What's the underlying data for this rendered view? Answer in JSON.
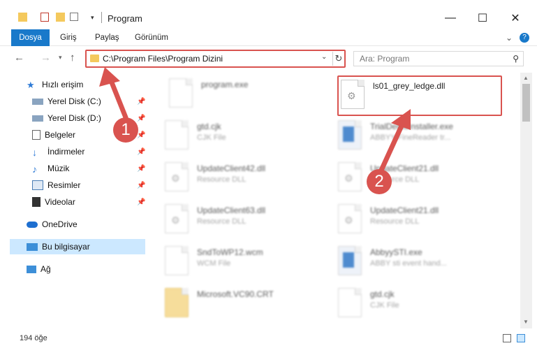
{
  "window": {
    "title": "Program",
    "minimize": "—",
    "maximize": "☐",
    "close": "✕"
  },
  "ribbon": {
    "tabs": [
      "Dosya",
      "Giriş",
      "Paylaş",
      "Görünüm"
    ],
    "collapse": "⌄",
    "help": "?"
  },
  "address": {
    "path": "C:\\Program Files\\Program Dizini",
    "dropdown": "⌄",
    "refresh": "↻",
    "search_placeholder": "Ara: Program"
  },
  "sidebar": {
    "quick_access": "Hızlı erişim",
    "items": [
      {
        "label": "Yerel Disk (C:)"
      },
      {
        "label": "Yerel Disk (D:)"
      },
      {
        "label": "Belgeler"
      },
      {
        "label": "İndirmeler"
      },
      {
        "label": "Müzik"
      },
      {
        "label": "Resimler"
      },
      {
        "label": "Videolar"
      }
    ],
    "onedrive": "OneDrive",
    "this_pc": "Bu bilgisayar",
    "network": "Ağ"
  },
  "files": [
    {
      "name": "program.exe",
      "type": ""
    },
    {
      "name": "ls01_grey_ledge.dll",
      "type": ""
    },
    {
      "name": "gtd.cjk",
      "type": "CJK File"
    },
    {
      "name": "TrialDemoInstaller.exe",
      "type": "ABBYY FineReader tr..."
    },
    {
      "name": "UpdateClient42.dll",
      "type": "Resource DLL"
    },
    {
      "name": "UpdateClient21.dll",
      "type": "Resource DLL"
    },
    {
      "name": "UpdateClient63.dll",
      "type": "Resource DLL"
    },
    {
      "name": "UpdateClient21.dll",
      "type": "Resource DLL"
    },
    {
      "name": "SndToWP12.wcm",
      "type": "WCM File"
    },
    {
      "name": "AbbyySTI.exe",
      "type": "ABBY sti event hand..."
    },
    {
      "name": "Microsoft.VC90.CRT",
      "type": ""
    },
    {
      "name": "gtd.cjk",
      "type": "CJK File"
    }
  ],
  "status": {
    "count": "194 öğe"
  },
  "markers": [
    "1",
    "2"
  ],
  "colors": {
    "accent": "#1979ca",
    "highlight": "#d9534f",
    "selected": "#cce8ff"
  }
}
